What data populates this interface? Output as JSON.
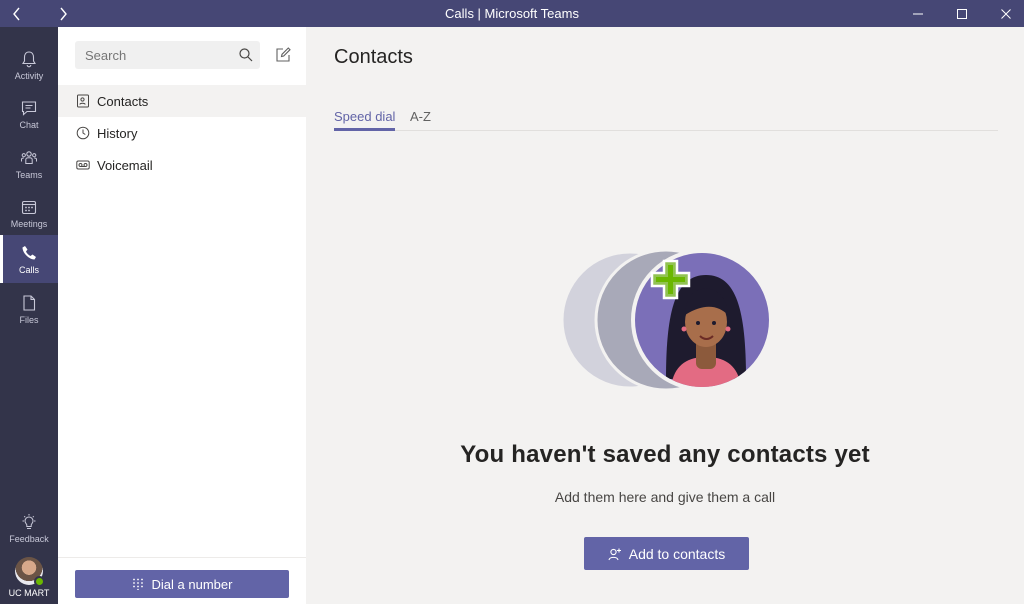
{
  "window": {
    "title": "Calls | Microsoft Teams"
  },
  "rail": {
    "items": [
      {
        "label": "Activity",
        "icon": "bell-icon"
      },
      {
        "label": "Chat",
        "icon": "chat-icon"
      },
      {
        "label": "Teams",
        "icon": "teams-icon"
      },
      {
        "label": "Meetings",
        "icon": "calendar-icon"
      },
      {
        "label": "Calls",
        "icon": "phone-icon"
      },
      {
        "label": "Files",
        "icon": "file-icon"
      }
    ],
    "feedback_label": "Feedback",
    "user_label": "UC MART"
  },
  "listpane": {
    "search_placeholder": "Search",
    "nav": [
      {
        "label": "Contacts",
        "icon": "contacts-icon"
      },
      {
        "label": "History",
        "icon": "clock-icon"
      },
      {
        "label": "Voicemail",
        "icon": "voicemail-icon"
      }
    ],
    "dial_label": "Dial a number"
  },
  "main": {
    "title": "Contacts",
    "tabs": [
      {
        "label": "Speed dial"
      },
      {
        "label": "A-Z"
      }
    ],
    "empty_title": "You haven't saved any contacts yet",
    "empty_subtitle": "Add them here and give them a call",
    "add_label": "Add to contacts"
  },
  "colors": {
    "titlebar": "#464775",
    "rail": "#33344a",
    "accent": "#6264a7",
    "presence": "#6bb700"
  }
}
